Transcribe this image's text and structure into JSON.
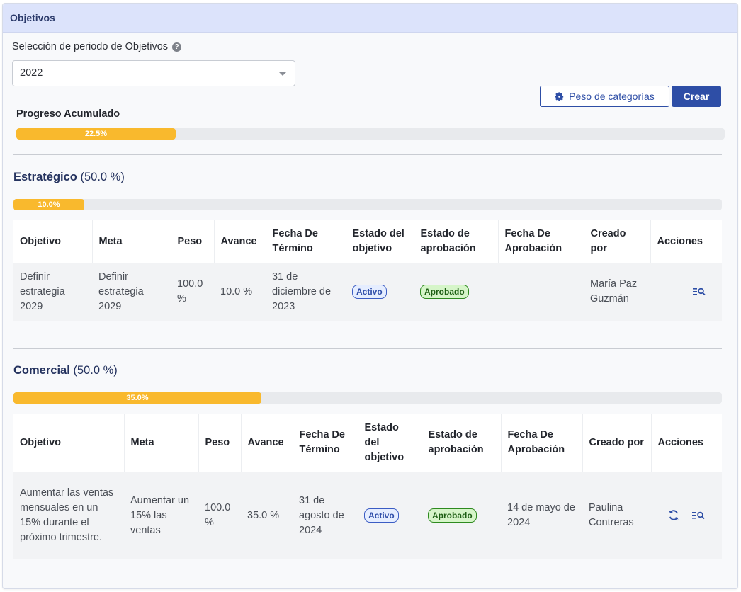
{
  "card": {
    "title": "Objetivos"
  },
  "period": {
    "label": "Selección de periodo de Objetivos",
    "help_icon": "question-circle-icon",
    "selected": "2022"
  },
  "toolbar": {
    "weights_label": "Peso de categorías",
    "weights_icon": "gear-icon",
    "create_label": "Crear"
  },
  "progress": {
    "title": "Progreso Acumulado",
    "value_label": "22.5%",
    "value": 22.5
  },
  "colors": {
    "accent": "#2e4ea6",
    "progress": "#f9b92d",
    "header_bg": "#dce3fb"
  },
  "columns_a": [
    "Objetivo",
    "Meta",
    "Peso",
    "Avance",
    "Fecha De Término",
    "Estado del objetivo",
    "Estado de aprobación",
    "Fecha De Aprobación",
    "Creado por",
    "Acciones"
  ],
  "sections": [
    {
      "name": "Estratégico",
      "weight": "(50.0 %)",
      "progress_label": "10.0%",
      "progress": 10.0,
      "rows": [
        {
          "objetivo": "Definir estrategia 2029",
          "meta": "Definir estrategia 2029",
          "peso": "100.0 %",
          "avance": "10.0 %",
          "fecha_termino": "31 de diciembre de 2023",
          "estado_objetivo": "Activo",
          "estado_aprobacion": "Aprobado",
          "fecha_aprobacion": "",
          "creado_por": "María Paz Guzmán",
          "actions": [
            "view-details-icon"
          ]
        }
      ]
    },
    {
      "name": "Comercial",
      "weight": "(50.0 %)",
      "progress_label": "35.0%",
      "progress": 35.0,
      "rows": [
        {
          "objetivo": "Aumentar las ventas mensuales en un 15% durante el próximo trimestre.",
          "meta": "Aumentar un 15% las ventas",
          "peso": "100.0 %",
          "avance": "35.0 %",
          "fecha_termino": "31 de agosto de 2024",
          "estado_objetivo": "Activo",
          "estado_aprobacion": "Aprobado",
          "fecha_aprobacion": "14 de mayo de 2024",
          "creado_por": "Paulina Contreras",
          "actions": [
            "refresh-icon",
            "view-details-icon"
          ]
        }
      ]
    }
  ]
}
